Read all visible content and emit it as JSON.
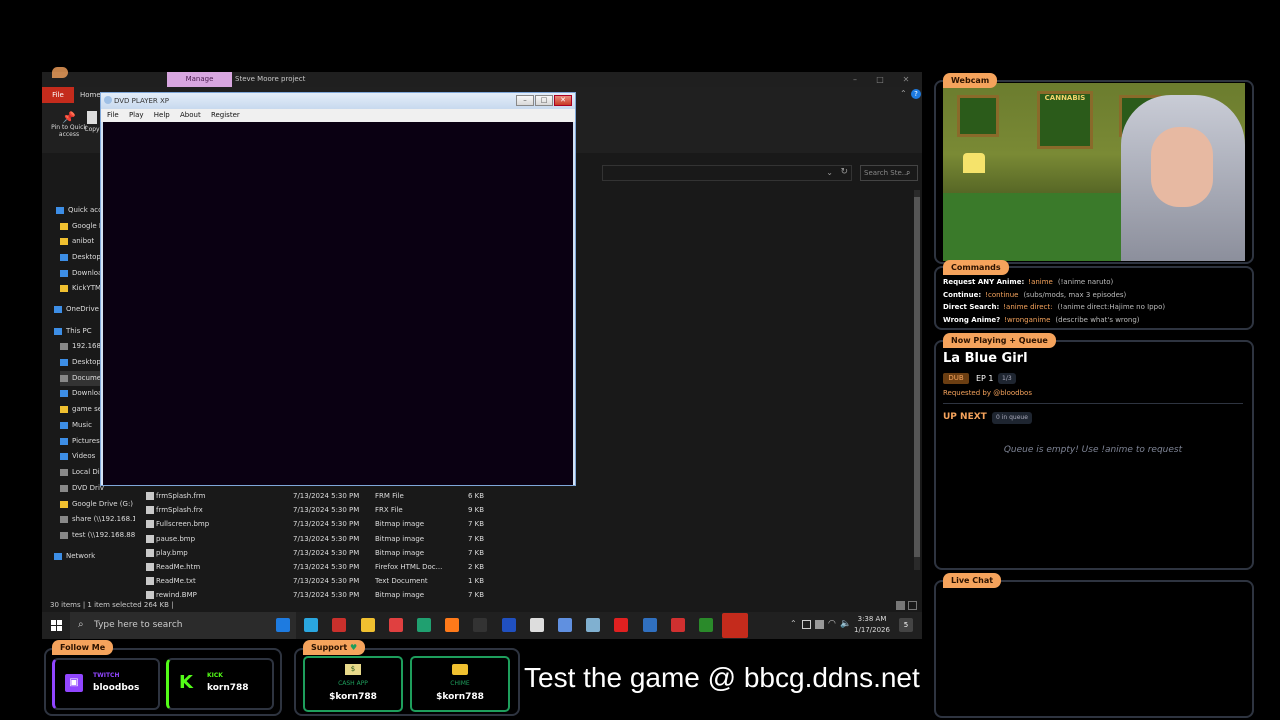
{
  "explorer": {
    "manage_tab": "Manage",
    "title": "Steve Moore project",
    "file_tab": "File",
    "home_tab": "Home",
    "pin_label": "Pin to Quick access",
    "copy_label": "Copy",
    "search_placeholder": "Search Ste...",
    "nav": [
      "Quick acce",
      "Google D",
      "anibot",
      "Desktop",
      "Downloa",
      "KickYTM",
      "OneDrive -",
      "This PC",
      "192.168.1",
      "Desktop",
      "Docume",
      "Downloa",
      "game ses",
      "Music",
      "Pictures",
      "Videos",
      "Local Dis",
      "DVD Driv",
      "Google Drive (G:)",
      "share (\\\\192.168.1.2",
      "test (\\\\192.168.88.12",
      "Network"
    ],
    "files": [
      {
        "name": "frmSplash.frm",
        "date": "7/13/2024 5:30 PM",
        "type": "FRM File",
        "size": "6 KB"
      },
      {
        "name": "frmSplash.frx",
        "date": "7/13/2024 5:30 PM",
        "type": "FRX File",
        "size": "9 KB"
      },
      {
        "name": "Fullscreen.bmp",
        "date": "7/13/2024 5:30 PM",
        "type": "Bitmap image",
        "size": "7 KB"
      },
      {
        "name": "pause.bmp",
        "date": "7/13/2024 5:30 PM",
        "type": "Bitmap image",
        "size": "7 KB"
      },
      {
        "name": "play.bmp",
        "date": "7/13/2024 5:30 PM",
        "type": "Bitmap image",
        "size": "7 KB"
      },
      {
        "name": "ReadMe.htm",
        "date": "7/13/2024 5:30 PM",
        "type": "Firefox HTML Doc...",
        "size": "2 KB"
      },
      {
        "name": "ReadMe.txt",
        "date": "7/13/2024 5:30 PM",
        "type": "Text Document",
        "size": "1 KB"
      },
      {
        "name": "rewind.BMP",
        "date": "7/13/2024 5:30 PM",
        "type": "Bitmap image",
        "size": "7 KB"
      }
    ],
    "status": "30 items  |  1 item selected  264 KB  |"
  },
  "dvd": {
    "title": "DVD PLAYER XP",
    "menu": [
      "File",
      "Play",
      "Help",
      "About",
      "Register"
    ]
  },
  "taskbar": {
    "search_placeholder": "Type here to search",
    "time": "3:38 AM",
    "date": "1/17/2026",
    "notif_count": "5"
  },
  "overlay": {
    "webcam_label": "Webcam",
    "poster_text": "CANNABIS",
    "commands_label": "Commands",
    "commands": [
      {
        "label": "Request ANY Anime:",
        "cmd": "!anime",
        "desc": "(!anime naruto)"
      },
      {
        "label": "Continue:",
        "cmd": "!continue",
        "desc": "(subs/mods, max 3 episodes)"
      },
      {
        "label": "Direct Search:",
        "cmd": "!anime direct:",
        "desc": "(!anime direct:Hajime no Ippo)"
      },
      {
        "label": "Wrong Anime?",
        "cmd": "!wronganime",
        "desc": "(describe what's wrong)"
      }
    ],
    "now_playing_label": "Now Playing + Queue",
    "anime_title": "La Blue Girl",
    "dub_tag": "DUB",
    "episode": "EP 1",
    "episode_of": "1/3",
    "requested_by": "Requested by @bloodbos",
    "up_next": "UP NEXT",
    "queue_count": "0 in queue",
    "queue_empty": "Queue is empty! Use !anime to request",
    "live_chat_label": "Live Chat",
    "follow_label": "Follow Me",
    "twitch_label": "TWITCH",
    "twitch_user": "bloodbos",
    "kick_label": "KICK",
    "kick_user": "korn788",
    "support_label": "Support",
    "cashapp_label": "CASH APP",
    "cashapp_user": "$korn788",
    "chime_label": "CHIME",
    "chime_user": "$korn788",
    "banner": "Test the game @ bbcg.ddns.net"
  },
  "colors": {
    "accent": "#f5a35c",
    "green": "#1e9e5c",
    "twitch": "#9146ff",
    "kick": "#53fc18"
  }
}
